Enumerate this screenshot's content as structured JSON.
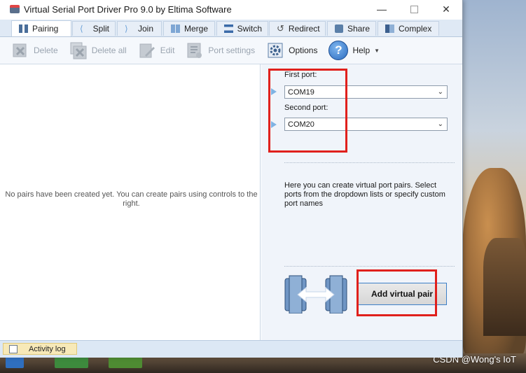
{
  "window": {
    "title": "Virtual Serial Port Driver Pro 9.0 by Eltima Software",
    "controls": [
      "minimize",
      "maximize",
      "close"
    ]
  },
  "tabs": [
    {
      "label": "Pairing",
      "icon": "pairing-icon",
      "active": true
    },
    {
      "label": "Split",
      "icon": "split-icon",
      "active": false
    },
    {
      "label": "Join",
      "icon": "join-icon",
      "active": false
    },
    {
      "label": "Merge",
      "icon": "merge-icon",
      "active": false
    },
    {
      "label": "Switch",
      "icon": "switch-icon",
      "active": false
    },
    {
      "label": "Redirect",
      "icon": "redirect-icon",
      "active": false
    },
    {
      "label": "Share",
      "icon": "share-icon",
      "active": false
    },
    {
      "label": "Complex",
      "icon": "complex-icon",
      "active": false
    }
  ],
  "toolbar": {
    "delete_label": "Delete",
    "delete_all_label": "Delete all",
    "edit_label": "Edit",
    "port_settings_label": "Port settings",
    "options_label": "Options",
    "help_label": "Help",
    "help_glyph": "?"
  },
  "left_pane": {
    "empty_message": "No pairs have been created yet. You can create pairs using controls to the right."
  },
  "right_pane": {
    "first_port_label": "First port:",
    "first_port_value": "COM19",
    "second_port_label": "Second port:",
    "second_port_value": "COM20",
    "description": "Here you can create virtual port pairs. Select ports from the dropdown lists or specify custom port names",
    "add_button_label": "Add virtual pair"
  },
  "status_bar": {
    "activity_log_label": "Activity log"
  },
  "desktop": {
    "watermark": "CSDN @Wong's IoT"
  },
  "colors": {
    "accent_blue": "#3c7fc7",
    "annotation_red": "#e0201c",
    "tab_bar": "#dfe9f5"
  }
}
